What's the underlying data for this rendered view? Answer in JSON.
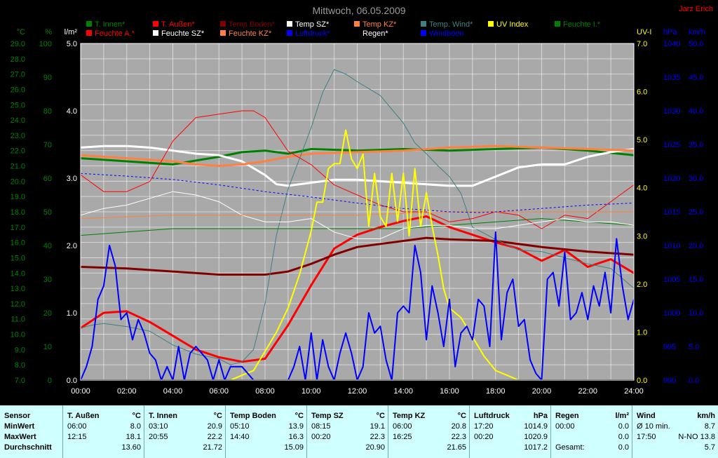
{
  "chart_data": {
    "type": "line",
    "title": "Mittwoch, 06.05.2009",
    "author": "Jarz Erich",
    "x_tick_labels": [
      "00:00",
      "02:00",
      "04:00",
      "06:00",
      "08:00",
      "10:00",
      "12:00",
      "14:00",
      "16:00",
      "18:00",
      "20:00",
      "22:00",
      "24:00"
    ],
    "axes": {
      "temp": {
        "unit": "°C",
        "range": [
          7.0,
          29.0
        ],
        "color": "#008000",
        "ticks": [
          "7.0",
          "8.0",
          "9.0",
          "10.0",
          "11.0",
          "12.0",
          "13.0",
          "14.0",
          "15.0",
          "16.0",
          "17.0",
          "18.0",
          "19.0",
          "20.0",
          "21.0",
          "22.0",
          "23.0",
          "24.0",
          "25.0",
          "26.0",
          "27.0",
          "28.0",
          "29.0"
        ]
      },
      "humidity": {
        "unit": "%",
        "range": [
          0,
          100
        ],
        "color": "#008000",
        "ticks": [
          "0",
          "10",
          "20",
          "30",
          "40",
          "50",
          "60",
          "70",
          "80",
          "90",
          "100"
        ]
      },
      "rain": {
        "unit": "l/m²",
        "range": [
          0.0,
          5.0
        ],
        "color": "#000000",
        "ticks": [
          "0.0",
          "1.0",
          "2.0",
          "3.0",
          "4.0",
          "5.0"
        ]
      },
      "uv": {
        "unit": "UV-I",
        "range": [
          0.0,
          7.0
        ],
        "color": "#ffff00",
        "ticks": [
          "0.0",
          "1.0",
          "2.0",
          "3.0",
          "4.0",
          "5.0",
          "6.0",
          "7.0"
        ]
      },
      "pressure": {
        "unit": "hPa",
        "range": [
          990,
          1040
        ],
        "color": "#0000ff",
        "ticks": [
          "990",
          "995",
          "1000",
          "1005",
          "1010",
          "1015",
          "1020",
          "1025",
          "1030",
          "1035",
          "1040"
        ]
      },
      "wind": {
        "unit": "km/h",
        "range": [
          0.0,
          50.0
        ],
        "color": "#0000ff",
        "ticks": [
          "0.0",
          "5.0",
          "10.0",
          "15.0",
          "20.0",
          "25.0",
          "30.0",
          "35.0",
          "40.0",
          "45.0",
          "50.0"
        ]
      }
    },
    "legend": [
      {
        "name": "T. Innen*",
        "color": "#008000"
      },
      {
        "name": "T. Außen*",
        "color": "#ff0000"
      },
      {
        "name": "Temp Boden*",
        "color": "#800000"
      },
      {
        "name": "Temp SZ*",
        "color": "#ffffff"
      },
      {
        "name": "Temp KZ*",
        "color": "#ff8040"
      },
      {
        "name": "Temp. Wind*",
        "color": "#408080"
      },
      {
        "name": "UV Index",
        "color": "#ffff00"
      },
      {
        "name": "Feuchte I.*",
        "color": "#008000"
      },
      {
        "name": "Feuchte A.*",
        "color": "#ff0000"
      },
      {
        "name": "Feuchte SZ*",
        "color": "#ffffff"
      },
      {
        "name": "Feuchte KZ*",
        "color": "#ff8040"
      },
      {
        "name": "Luftdruck*",
        "color": "#0000ff"
      },
      {
        "name": "Regen*",
        "color": "#000000"
      },
      {
        "name": "Windböen",
        "color": "#0000ff"
      }
    ],
    "series": [
      {
        "name": "T. Innen*",
        "axis": "temp",
        "color": "#008000",
        "width": 3,
        "x": [
          0,
          2,
          4,
          6,
          7,
          8,
          9,
          10,
          12,
          14,
          16,
          18,
          20,
          22,
          24
        ],
        "y": [
          21.5,
          21.3,
          21.1,
          21.6,
          21.9,
          22.0,
          21.8,
          22.1,
          22.0,
          22.1,
          22.0,
          22.1,
          22.2,
          22.0,
          21.7
        ]
      },
      {
        "name": "T. Außen*",
        "axis": "temp",
        "color": "#ff0000",
        "width": 3,
        "x": [
          0,
          1,
          2,
          3,
          4,
          5,
          6,
          7,
          8,
          9,
          10,
          11,
          12,
          13,
          14,
          15,
          16,
          17,
          18,
          19,
          20,
          21,
          22,
          23,
          24
        ],
        "y": [
          10.4,
          11.4,
          11.5,
          10.8,
          9.9,
          9.0,
          8.5,
          8.2,
          8.4,
          10.6,
          13.2,
          15.6,
          16.5,
          17.0,
          17.4,
          17.7,
          17.0,
          16.5,
          16.0,
          15.6,
          14.8,
          15.5,
          14.4,
          14.9,
          14.0
        ]
      },
      {
        "name": "Temp Boden*",
        "axis": "temp",
        "color": "#800000",
        "width": 3,
        "x": [
          0,
          2,
          4,
          6,
          8,
          9,
          10,
          11,
          12,
          13,
          14,
          15,
          16,
          18,
          20,
          22,
          24
        ],
        "y": [
          14.4,
          14.3,
          14.1,
          13.9,
          13.9,
          14.1,
          14.6,
          15.2,
          15.7,
          15.9,
          16.1,
          16.3,
          16.2,
          16.1,
          15.7,
          15.4,
          15.2
        ]
      },
      {
        "name": "Temp SZ*",
        "axis": "temp",
        "color": "#ffffff",
        "width": 3,
        "x": [
          0,
          1,
          2,
          3,
          4,
          5,
          6,
          7,
          8,
          8.5,
          9,
          10,
          11,
          12,
          13,
          14,
          15,
          16,
          17,
          18,
          19,
          20,
          21,
          22,
          23,
          24
        ],
        "y": [
          22.2,
          22.3,
          22.3,
          22.2,
          22.0,
          21.8,
          21.7,
          21.3,
          20.4,
          19.8,
          19.7,
          19.9,
          20.1,
          20.1,
          20.0,
          19.9,
          19.8,
          19.7,
          19.7,
          20.3,
          20.9,
          21.1,
          21.1,
          21.6,
          21.9,
          22.1
        ]
      },
      {
        "name": "Temp KZ*",
        "axis": "temp",
        "color": "#ff8040",
        "width": 3,
        "x": [
          0,
          1,
          2,
          3,
          4,
          5,
          6,
          7,
          8,
          9,
          10,
          12,
          14,
          16,
          18,
          20,
          22,
          24
        ],
        "y": [
          21.7,
          21.6,
          21.5,
          21.4,
          21.3,
          21.1,
          21.0,
          21.1,
          21.3,
          21.6,
          21.8,
          21.9,
          22.0,
          22.2,
          22.3,
          22.2,
          22.1,
          22.0
        ]
      },
      {
        "name": "Temp. Wind*",
        "axis": "temp",
        "color": "#408080",
        "width": 1,
        "x": [
          0,
          0.5,
          1,
          2,
          3,
          4,
          5,
          6,
          6.5,
          7,
          7.5,
          8,
          8.5,
          9,
          10,
          10.5,
          11,
          11.5,
          12,
          13,
          14,
          14.5,
          15,
          15.5,
          16,
          16.5,
          17,
          18,
          19,
          20,
          21,
          22,
          23,
          24
        ],
        "y": [
          10.4,
          10.6,
          10.7,
          10.5,
          10.2,
          9.3,
          8.7,
          8.4,
          8.0,
          8.2,
          9.0,
          12.0,
          16.5,
          19.5,
          23.5,
          25.8,
          27.3,
          27.0,
          26.5,
          25.6,
          23.8,
          22.5,
          21.8,
          21.0,
          20.3,
          19.2,
          17.0,
          16.2,
          15.5,
          15.4,
          15.0,
          14.6,
          14.3,
          13.0
        ]
      },
      {
        "name": "Feuchte I.*",
        "axis": "humidity",
        "color": "#008000",
        "width": 1,
        "x": [
          0,
          2,
          4,
          6,
          8,
          10,
          12,
          14,
          16,
          18,
          20,
          22,
          24
        ],
        "y": [
          43,
          44,
          45,
          45,
          45,
          45,
          45,
          45,
          46,
          47,
          48,
          47,
          46
        ]
      },
      {
        "name": "Feuchte A.*",
        "axis": "humidity",
        "color": "#ff0000",
        "width": 1,
        "x": [
          0,
          1,
          2,
          3,
          4,
          5,
          6,
          7,
          7.5,
          8,
          9,
          10,
          11,
          12,
          13,
          14,
          15,
          16,
          17,
          18,
          19,
          20,
          21,
          22,
          23,
          24
        ],
        "y": [
          61,
          56,
          56,
          59,
          71,
          78,
          79,
          80,
          80,
          78,
          68,
          64,
          58,
          55,
          52,
          50,
          50,
          47,
          48,
          50,
          49,
          45,
          49,
          48,
          53,
          58
        ]
      },
      {
        "name": "Feuchte SZ*",
        "axis": "humidity",
        "color": "#ffffff",
        "width": 1,
        "x": [
          0,
          1,
          2,
          3,
          4,
          5,
          6,
          7,
          8,
          9,
          10,
          11,
          12,
          13,
          14,
          15,
          16,
          17,
          18,
          19,
          20,
          21,
          22,
          23,
          24
        ],
        "y": [
          49,
          51,
          52,
          54,
          56,
          55,
          53,
          49,
          47,
          47,
          48,
          44,
          42,
          42,
          45,
          46,
          46,
          45,
          45,
          46,
          47,
          48,
          47,
          47,
          46
        ]
      },
      {
        "name": "Feuchte KZ*",
        "axis": "humidity",
        "color": "#ff8040",
        "width": 1,
        "x": [
          0,
          4,
          8,
          12,
          16,
          20,
          24
        ],
        "y": [
          48,
          49,
          49,
          49,
          50,
          50,
          50
        ]
      },
      {
        "name": "Luftdruck*",
        "axis": "pressure",
        "color": "#0000ff",
        "width": 1,
        "dash": true,
        "x": [
          0,
          2,
          4,
          6,
          8,
          10,
          12,
          14,
          16,
          17.3,
          18,
          20,
          22,
          24
        ],
        "y": [
          1020.7,
          1020.3,
          1019.8,
          1019.0,
          1018.0,
          1017.2,
          1016.3,
          1015.5,
          1015.0,
          1014.9,
          1015.0,
          1015.5,
          1016.0,
          1016.3
        ]
      },
      {
        "name": "UV Index",
        "axis": "uv",
        "color": "#ffff00",
        "width": 2,
        "x": [
          0,
          6.5,
          7,
          7.5,
          8,
          8.5,
          9,
          9.5,
          10,
          10.25,
          10.5,
          10.75,
          11,
          11.25,
          11.5,
          11.75,
          12,
          12.25,
          12.5,
          12.75,
          13,
          13.25,
          13.5,
          13.75,
          14,
          14.25,
          14.5,
          14.75,
          15,
          15.25,
          15.5,
          15.75,
          16,
          16.5,
          17,
          17.5,
          18,
          18.5,
          19,
          24
        ],
        "y": [
          0,
          0,
          0.1,
          0.2,
          0.6,
          1.0,
          1.5,
          2.2,
          3.1,
          3.7,
          3.7,
          4.4,
          4.5,
          4.5,
          5.2,
          4.6,
          4.4,
          4.7,
          3.2,
          4.3,
          3.4,
          3.2,
          4.3,
          3.3,
          4.3,
          3.0,
          4.4,
          3.2,
          3.9,
          3.2,
          2.6,
          1.9,
          1.5,
          1.3,
          0.9,
          0.5,
          0.2,
          0.1,
          0,
          0
        ]
      },
      {
        "name": "Windböen",
        "axis": "wind",
        "color": "#0000ff",
        "width": 2,
        "x": [
          0,
          0.25,
          0.5,
          0.75,
          1,
          1.25,
          1.5,
          1.75,
          2,
          2.25,
          2.5,
          2.75,
          3,
          3.25,
          3.5,
          3.75,
          4,
          4.25,
          4.5,
          4.75,
          5,
          5.25,
          5.5,
          5.75,
          6,
          6.25,
          6.5,
          6.75,
          7,
          7.5,
          8,
          8.5,
          9,
          9.25,
          9.5,
          9.75,
          10,
          10.25,
          10.5,
          10.75,
          11,
          11.25,
          11.5,
          11.75,
          12,
          12.25,
          12.5,
          12.75,
          13,
          13.25,
          13.5,
          13.75,
          14,
          14.25,
          14.5,
          14.75,
          15,
          15.25,
          15.5,
          15.75,
          16,
          16.25,
          16.5,
          16.75,
          17,
          17.25,
          17.5,
          17.75,
          18,
          18.25,
          18.5,
          18.75,
          19,
          19.25,
          19.5,
          19.75,
          20,
          20.25,
          20.5,
          20.75,
          21,
          21.25,
          21.5,
          21.75,
          22,
          22.25,
          22.5,
          22.75,
          23,
          23.25,
          23.5,
          23.75,
          24
        ],
        "y": [
          0,
          2,
          5,
          12,
          14,
          20,
          17,
          9,
          10,
          6,
          9,
          7,
          4,
          3,
          0,
          2,
          0,
          5,
          0,
          4,
          5,
          4,
          3,
          0,
          3,
          0,
          2,
          2,
          2,
          0,
          0,
          0,
          0,
          2,
          5,
          0,
          7,
          0,
          6,
          2,
          0,
          4,
          7,
          4,
          0,
          2,
          10,
          7,
          8,
          3,
          0,
          10,
          11,
          10,
          20,
          16,
          6,
          14,
          10,
          5,
          12,
          2,
          7,
          8,
          6,
          12,
          11,
          5,
          22,
          6,
          13,
          15,
          8,
          9,
          3,
          1,
          0,
          15,
          16,
          11,
          19,
          9,
          10,
          13,
          9,
          14,
          11,
          16,
          10,
          21,
          14,
          9,
          12
        ]
      },
      {
        "name": "Regen*",
        "axis": "rain",
        "color": "#000000",
        "width": 2,
        "x": [
          0,
          24
        ],
        "y": [
          0,
          0
        ]
      }
    ]
  },
  "stats_table": {
    "sensor": {
      "label": "Sensor",
      "min": "MinWert",
      "max": "MaxWert",
      "avg": "Durchschnitt"
    },
    "columns": [
      {
        "name": "T. Außen",
        "unit": "°C",
        "min_time": "06:00",
        "min": "8.0",
        "max_time": "12:15",
        "max": "18.1",
        "avg": "13.60"
      },
      {
        "name": "T. Innen",
        "unit": "°C",
        "min_time": "03:10",
        "min": "20.9",
        "max_time": "20:55",
        "max": "22.2",
        "avg": "21.72"
      },
      {
        "name": "Temp Boden",
        "unit": "°C",
        "min_time": "05:10",
        "min": "13.9",
        "max_time": "14:40",
        "max": "16.3",
        "avg": "15.09"
      },
      {
        "name": "Temp SZ",
        "unit": "°C",
        "min_time": "08:15",
        "min": "19.1",
        "max_time": "00:20",
        "max": "22.3",
        "avg": "20.90"
      },
      {
        "name": "Temp KZ",
        "unit": "°C",
        "min_time": "06:00",
        "min": "20.8",
        "max_time": "16:25",
        "max": "22.3",
        "avg": "21.65"
      },
      {
        "name": "Luftdruck",
        "unit": "hPa",
        "min_time": "17:20",
        "min": "1014.9",
        "max_time": "00:20",
        "max": "1020.9",
        "avg": "1017.2"
      },
      {
        "name": "Regen",
        "unit": "l/m²",
        "min_time": "00:00",
        "min": "0.0",
        "max_time": "",
        "max": "0.0",
        "avg_label": "Gesamt:",
        "avg": "0.0"
      },
      {
        "name": "Wind",
        "unit": "km/h",
        "min_time": "Ø 10 min.",
        "min": "8.7",
        "max_time": "17:50",
        "max_extra": "N-NO",
        "max": "13.8",
        "avg": "5.7"
      }
    ]
  }
}
